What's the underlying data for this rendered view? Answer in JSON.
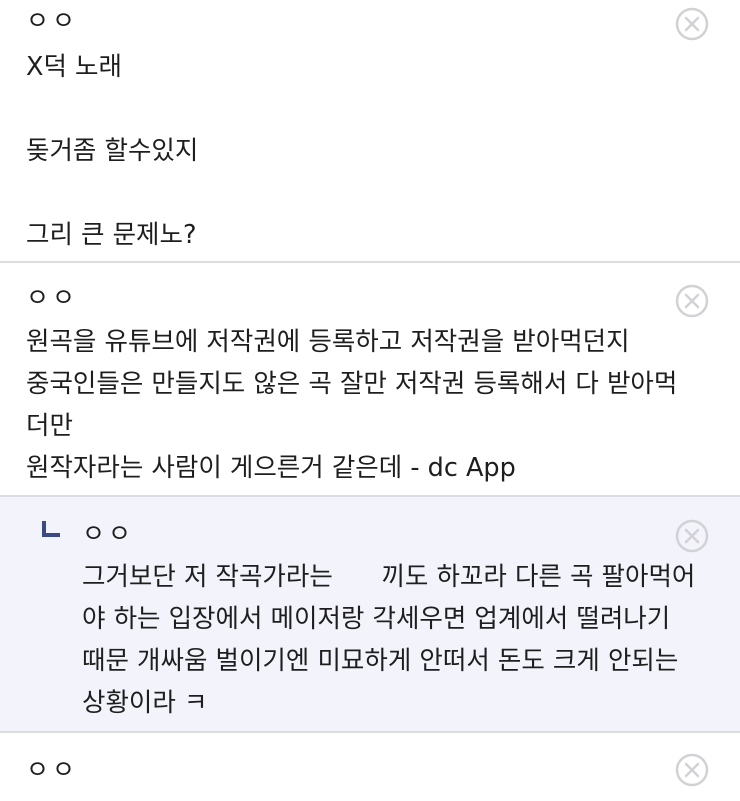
{
  "icons": {
    "delete": "close-circle-icon",
    "reply": "reply-arrow-icon"
  },
  "colors": {
    "reply_background": "#f3f4fb",
    "divider": "#dcdde3",
    "reply_marker": "#3b4a86",
    "delete_icon": "#d2d2d6"
  },
  "comments": [
    {
      "author": "ㅇㅇ",
      "text": "X덕 노래\n\n돚거좀 할수있지\n\n그리 큰 문제노?"
    },
    {
      "author": "ㅇㅇ",
      "text": "원곡을 유튜브에 저작권에 등록하고 저작권을 받아먹던지\n중국인들은 만들지도 않은 곡 잘만 저작권 등록해서 다 받아먹\n더만\n원작자라는 사람이 게으른거 같은데 - dc App"
    },
    {
      "author": "ㅇㅇ",
      "text": "그거보단 저 작곡가라는      끼도 하꼬라 다른 곡 팔아먹어\n야 하는 입장에서 메이저랑 각세우면 업계에서 떨려나기\n때문 개싸움 벌이기엔 미묘하게 안떠서 돈도 크게 안되는\n상황이라 ㅋ"
    },
    {
      "author": "ㅇㅇ",
      "text": ""
    }
  ]
}
